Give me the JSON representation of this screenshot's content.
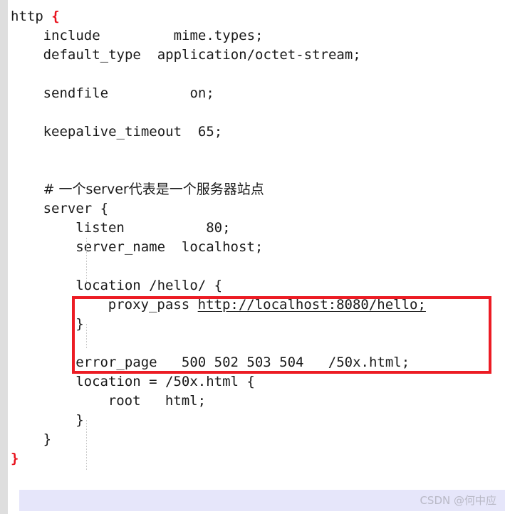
{
  "window": {
    "title": "nginx.conf code snippet",
    "background_color": "#ffffff",
    "gutter_color": "#dedede",
    "highlight_band_color": "#e6e6fa",
    "annotation_color": "#ec1c24",
    "text_color": "#1a1a1a"
  },
  "editor": {
    "lines": [
      {
        "indent": 0,
        "text": "http ",
        "brace": "{",
        "brace_red": true
      },
      {
        "indent": 1,
        "text": "include         mime.types;"
      },
      {
        "indent": 1,
        "text": "default_type  application/octet-stream;"
      },
      {
        "indent": 0,
        "text": ""
      },
      {
        "indent": 1,
        "text": "sendfile          on;"
      },
      {
        "indent": 0,
        "text": ""
      },
      {
        "indent": 1,
        "text": "keepalive_timeout  65;"
      },
      {
        "indent": 0,
        "text": ""
      },
      {
        "indent": 0,
        "text": ""
      },
      {
        "indent": 1,
        "text": "# 一个server代表是一个服务器站点",
        "cjk": true
      },
      {
        "indent": 1,
        "text": "server {"
      },
      {
        "indent": 2,
        "text": "listen          80;"
      },
      {
        "indent": 2,
        "text": "server_name  localhost;"
      },
      {
        "indent": 0,
        "text": ""
      },
      {
        "indent": 2,
        "text": "location /hello/ {"
      },
      {
        "indent": 3,
        "text": "proxy_pass ",
        "link": "http://localhost:8080/hello;"
      },
      {
        "indent": 2,
        "text": "}"
      },
      {
        "indent": 0,
        "text": ""
      },
      {
        "indent": 2,
        "text": "error_page   500 502 503 504   /50x.html;"
      },
      {
        "indent": 2,
        "text": "location = /50x.html {"
      },
      {
        "indent": 3,
        "text": "root   html;"
      },
      {
        "indent": 2,
        "text": "}"
      },
      {
        "indent": 1,
        "text": "}"
      },
      {
        "indent": 0,
        "text": "",
        "brace": "}",
        "brace_red": true,
        "highlighted": true
      }
    ],
    "annotation": {
      "shape": "rectangle",
      "color": "#ec1c24",
      "covers": [
        "location /hello/ {",
        "proxy_pass http://localhost:8080/hello;",
        "}"
      ]
    },
    "link_text": "http://localhost:8080/hello;"
  },
  "watermark": {
    "text": "CSDN @何中应"
  }
}
